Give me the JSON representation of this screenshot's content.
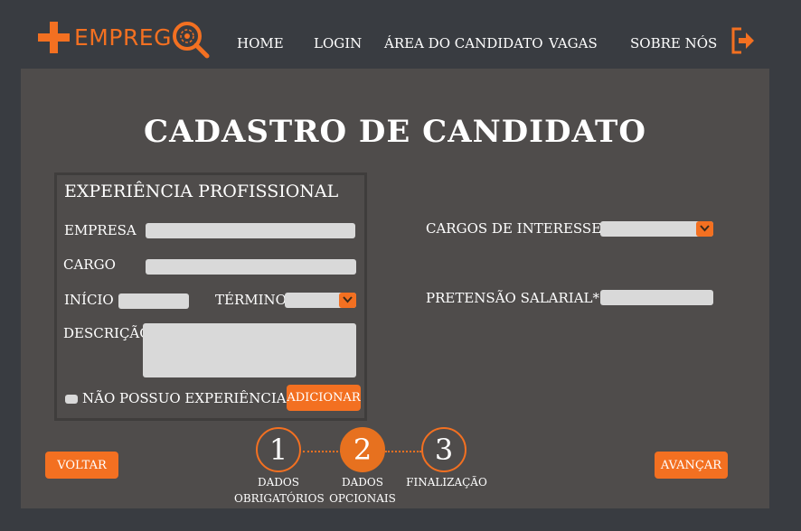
{
  "brand": {
    "name": "EMPREG",
    "accent": "#f37021"
  },
  "nav": {
    "home": "HOME",
    "login": "LOGIN",
    "candidate_area": "ÁREA DO CANDIDATO",
    "jobs": "VAGAS",
    "about": "SOBRE NÓS",
    "exit_icon": "exit-icon"
  },
  "page": {
    "title": "CADASTRO DE CANDIDATO"
  },
  "experience": {
    "title": "EXPERIÊNCIA PROFISSIONAL",
    "company_label": "EMPRESA",
    "role_label": "CARGO",
    "start_label": "INÍCIO",
    "end_label": "TÉRMINO",
    "description_label": "DESCRIÇÃO",
    "no_experience_label": "NÃO POSSUO EXPERIÊNCIA",
    "add_button": "ADICIONAR"
  },
  "right": {
    "positions_label": "CARGOS DE INTERESSE*",
    "salary_label": "PRETENSÃO SALARIAL*"
  },
  "actions": {
    "back": "VOLTAR",
    "next": "AVANÇAR"
  },
  "steps": [
    {
      "number": "1",
      "line1": "DADOS",
      "line2": "OBRIGATÓRIOS",
      "active": false
    },
    {
      "number": "2",
      "line1": "DADOS",
      "line2": "OPCIONAIS",
      "active": true
    },
    {
      "number": "3",
      "line1": "FINALIZAÇÃO",
      "line2": "",
      "active": false
    }
  ]
}
